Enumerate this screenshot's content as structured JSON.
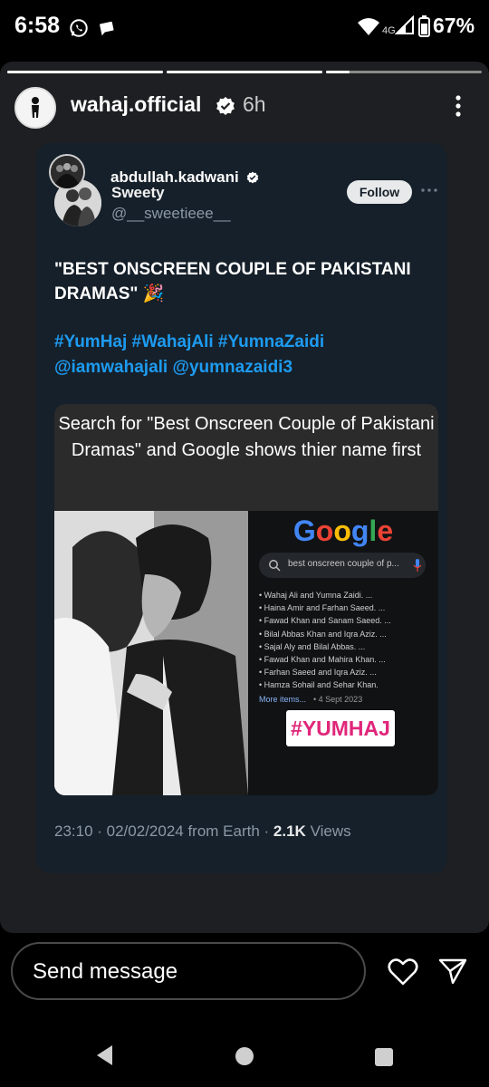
{
  "status_bar": {
    "time": "6:58",
    "network": "4G",
    "battery": "67%"
  },
  "story": {
    "username": "wahaj.official",
    "time_ago": "6h",
    "progress": [
      1,
      1,
      0.15
    ]
  },
  "post": {
    "sharer": "abdullah.kadwani",
    "display_name": "Sweety",
    "handle": "@__sweetieee__",
    "follow_label": "Follow",
    "text": "\"BEST ONSCREEN COUPLE OF PAKISTANI DRAMAS\" 🎉",
    "tags": "#YumHaj #WahajAli #YumnaZaidi @iamwahajali @yumnazaidi3",
    "media": {
      "caption": "Search for \"Best Onscreen Couple of Pakistani Dramas\" and Google shows thier name first",
      "google_logo": "Google",
      "search_query": "best onscreen couple of p...",
      "results": [
        "Wahaj Ali and Yumna Zaidi. ...",
        "Haina Amir and Farhan Saeed. ...",
        "Fawad Khan and Sanam Saeed. ...",
        "Bilal Abbas Khan and Iqra Aziz. ...",
        "Sajal Aly and Bilal Abbas. ...",
        "Fawad Khan and Mahira Khan. ...",
        "Farhan Saeed and Iqra Aziz. ...",
        "Hamza Sohail and Sehar Khan."
      ],
      "more_items": "More items...",
      "date": "• 4 Sept 2023",
      "hashtag_badge": "#YUMHAJ"
    },
    "meta": "23:10 · 02/02/2024 from Earth · ",
    "views_count": "2.1K",
    "views_label": " Views"
  },
  "reply": {
    "placeholder": "Send message"
  },
  "colors": {
    "link": "#1d9bf0",
    "card_bg": "#16202a",
    "badge_text": "#e0267a"
  }
}
